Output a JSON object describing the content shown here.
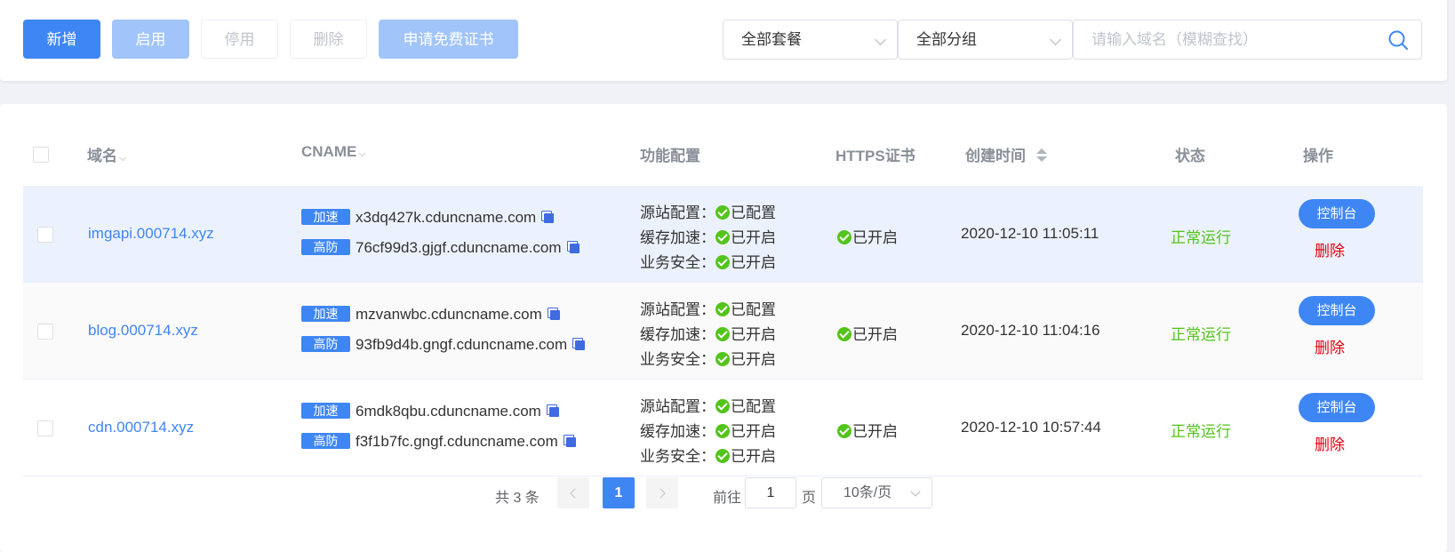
{
  "toolbar": {
    "add_label": "新增",
    "enable_label": "启用",
    "disable_label": "停用",
    "delete_label": "删除",
    "cert_label": "申请免费证书",
    "package_filter": "全部套餐",
    "group_filter": "全部分组",
    "search_placeholder": "请输入域名（模糊查找）"
  },
  "table": {
    "headers": {
      "domain": "域名",
      "cname": "CNAME",
      "features": "功能配置",
      "https": "HTTPS证书",
      "created": "创建时间",
      "status": "状态",
      "actions": "操作"
    },
    "rows": [
      {
        "domain": "imgapi.000714.xyz",
        "cname_accel_tag": "加速",
        "cname_accel": "x3dq427k.cduncname.com",
        "cname_ddos_tag": "高防",
        "cname_ddos": "76cf99d3.gjgf.cduncname.com",
        "origin_label": "源站配置：",
        "origin_value": "已配置",
        "cache_label": "缓存加速：",
        "cache_value": "已开启",
        "security_label": "业务安全：",
        "security_value": "已开启",
        "https": "已开启",
        "created": "2020-12-10 11:05:11",
        "status": "正常运行",
        "console": "控制台",
        "delete": "删除"
      },
      {
        "domain": "blog.000714.xyz",
        "cname_accel_tag": "加速",
        "cname_accel": "mzvanwbc.cduncname.com",
        "cname_ddos_tag": "高防",
        "cname_ddos": "93fb9d4b.gngf.cduncname.com",
        "origin_label": "源站配置：",
        "origin_value": "已配置",
        "cache_label": "缓存加速：",
        "cache_value": "已开启",
        "security_label": "业务安全：",
        "security_value": "已开启",
        "https": "已开启",
        "created": "2020-12-10 11:04:16",
        "status": "正常运行",
        "console": "控制台",
        "delete": "删除"
      },
      {
        "domain": "cdn.000714.xyz",
        "cname_accel_tag": "加速",
        "cname_accel": "6mdk8qbu.cduncname.com",
        "cname_ddos_tag": "高防",
        "cname_ddos": "f3f1b7fc.gngf.cduncname.com",
        "origin_label": "源站配置：",
        "origin_value": "已配置",
        "cache_label": "缓存加速：",
        "cache_value": "已开启",
        "security_label": "业务安全：",
        "security_value": "已开启",
        "https": "已开启",
        "created": "2020-12-10 10:57:44",
        "status": "正常运行",
        "console": "控制台",
        "delete": "删除"
      }
    ]
  },
  "pagination": {
    "total": "共 3 条",
    "current_page": "1",
    "goto_prefix": "前往",
    "goto_value": "1",
    "goto_suffix": "页",
    "page_size": "10条/页"
  },
  "colors": {
    "primary": "#3f86f5",
    "success": "#52c41a",
    "danger": "#e60012"
  }
}
